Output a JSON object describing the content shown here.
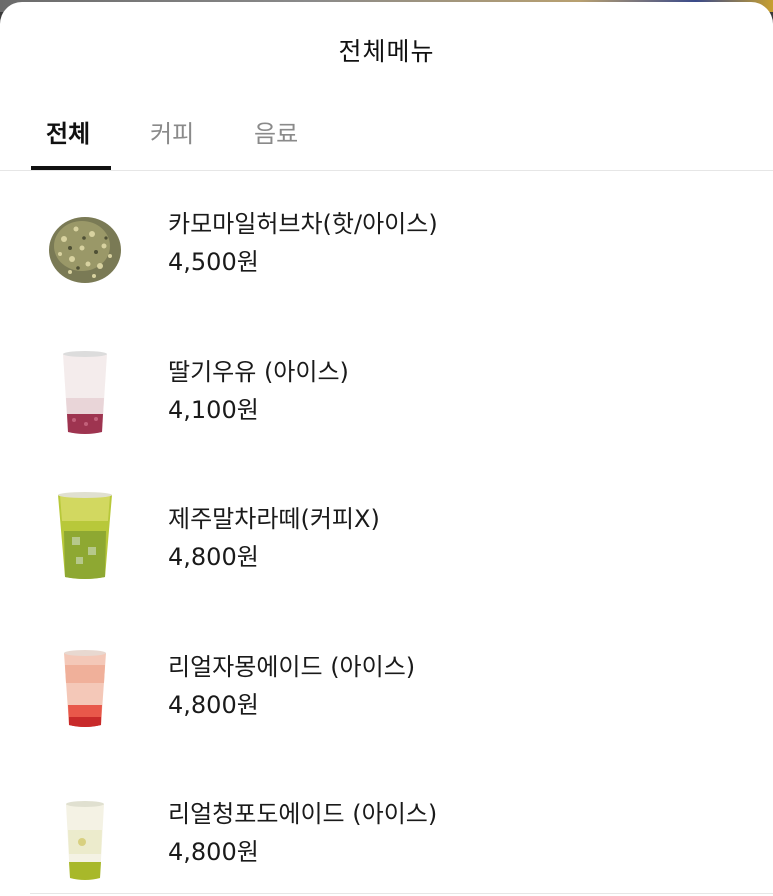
{
  "header": {
    "title": "전체메뉴"
  },
  "tabs": [
    {
      "label": "전체",
      "active": true
    },
    {
      "label": "커피",
      "active": false
    },
    {
      "label": "음료",
      "active": false
    }
  ],
  "menu": [
    {
      "name": "카모마일허브차(핫/아이스)",
      "price": "4,500원",
      "icon": "chamomile-tea-leaves"
    },
    {
      "name": "딸기우유 (아이스)",
      "price": "4,100원",
      "icon": "strawberry-milk-cup"
    },
    {
      "name": "제주말차라떼(커피X)",
      "price": "4,800원",
      "icon": "matcha-latte-cup"
    },
    {
      "name": "리얼자몽에이드 (아이스)",
      "price": "4,800원",
      "icon": "grapefruit-ade-cup"
    },
    {
      "name": "리얼청포도에이드 (아이스)",
      "price": "4,800원",
      "icon": "green-grape-ade-cup"
    }
  ],
  "colors": {
    "accent": "#111111",
    "inactive_tab": "#8a8a8a",
    "divider": "#e6e6e6"
  }
}
